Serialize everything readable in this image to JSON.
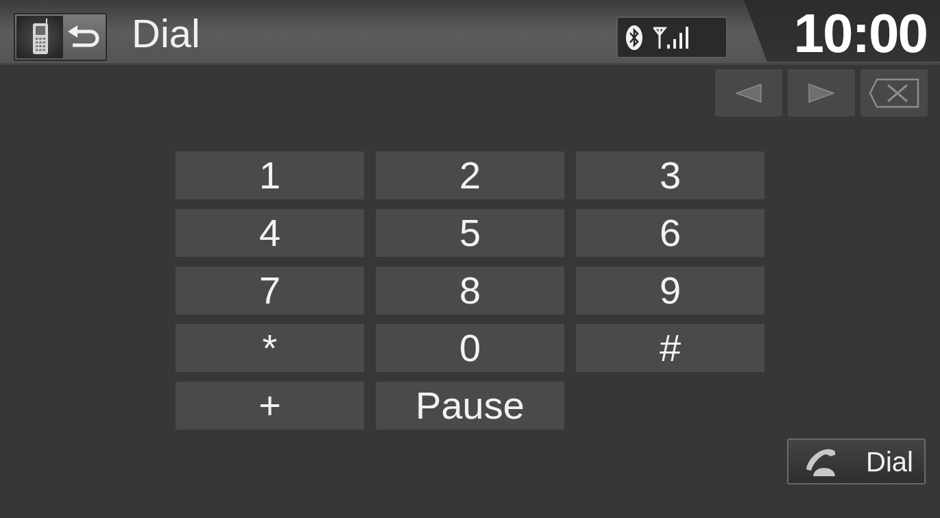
{
  "header": {
    "title": "Dial",
    "clock": "10:00"
  },
  "edit_buttons": [
    {
      "kind": "cursor_left",
      "disabled": true
    },
    {
      "kind": "cursor_right",
      "disabled": true
    },
    {
      "kind": "delete",
      "disabled": true
    }
  ],
  "keypad": [
    "1",
    "2",
    "3",
    "4",
    "5",
    "6",
    "7",
    "8",
    "9",
    "*",
    "0",
    "#",
    "+",
    "Pause"
  ],
  "dial_button": {
    "label": "Dial"
  }
}
